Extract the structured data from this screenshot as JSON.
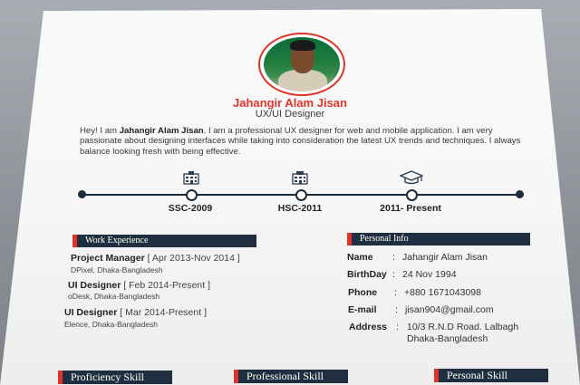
{
  "profile": {
    "name": "Jahangir Alam Jisan",
    "role": "UX/UI Designer",
    "intro_prefix": "Hey! I am ",
    "intro_bold": "Jahangir Alam Jisan",
    "intro_rest": ". I am a professional UX designer for web and mobile application. I am very passionate about designing interfaces while taking into consideration the latest UX trends and techniques. I always balance looking fresh with being effective."
  },
  "timeline": {
    "items": [
      {
        "label": "SSC-2009",
        "icon": "school-building-icon"
      },
      {
        "label": "HSC-2011",
        "icon": "college-building-icon"
      },
      {
        "label": "2011- Present",
        "icon": "graduation-cap-icon"
      }
    ]
  },
  "work": {
    "heading": "Work Experience",
    "jobs": [
      {
        "title": "Project Manager",
        "dates": " [ Apr 2013-Nov 2014 ]",
        "company": "DPixel, Dhaka-Bangladesh"
      },
      {
        "title": "UI Designer",
        "dates": " [ Feb 2014-Present ]",
        "company": "oDesk, Dhaka-Bangladesh"
      },
      {
        "title": "UI Designer",
        "dates": " [ Mar 2014-Present ]",
        "company": "Elence, Dhaka-Bangladesh"
      }
    ]
  },
  "personal": {
    "heading": "Personal Info",
    "rows": [
      {
        "label": "Name",
        "value": "Jahangir Alam Jisan"
      },
      {
        "label": "BirthDay",
        "value": "24 Nov 1994"
      },
      {
        "label": "Phone",
        "value": "+880 1671043098"
      },
      {
        "label": "E-mail",
        "value": "jisan904@gmail.com"
      },
      {
        "label": "Address",
        "value": "10/3 R.N.D Road. Lalbagh",
        "value2": "Dhaka-Bangladesh"
      }
    ]
  },
  "bottom": {
    "proficiency": "Proficiency Skill",
    "professional": "Professional Skill",
    "personal": "Personal Skill"
  },
  "colors": {
    "accent": "#e0342a",
    "navy": "#1f2f3f"
  }
}
